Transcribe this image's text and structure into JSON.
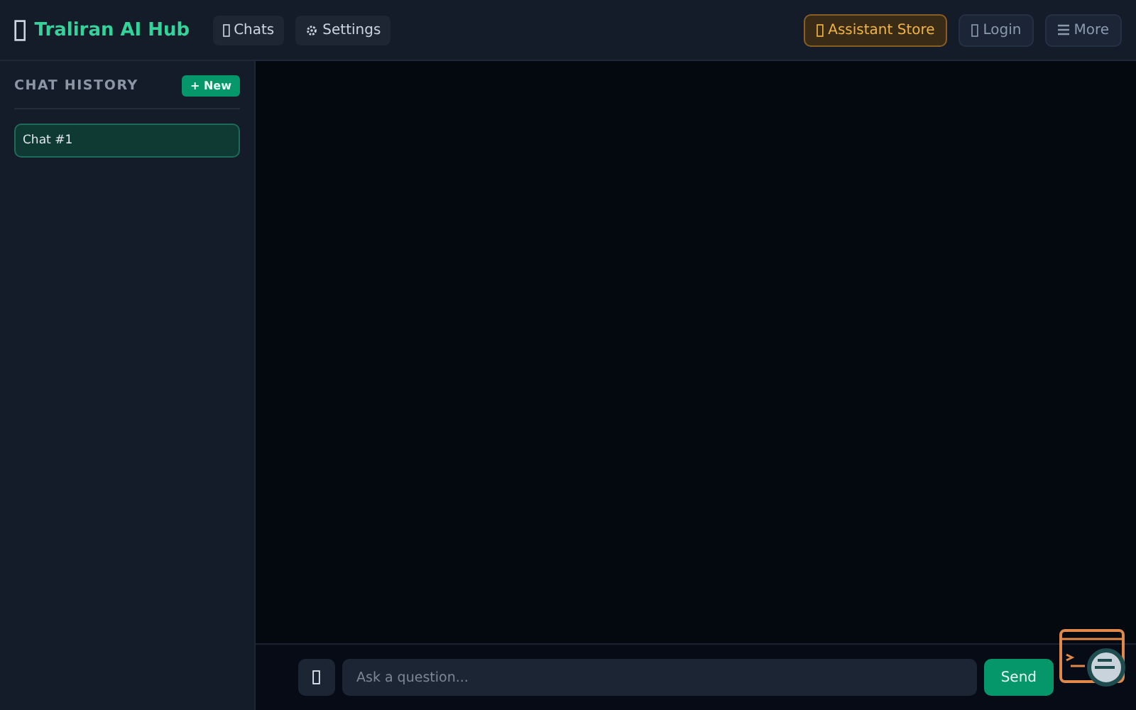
{
  "header": {
    "title": "Traliran AI Hub",
    "nav": [
      {
        "label": "Chats",
        "kind": "box"
      },
      {
        "label": "Settings",
        "kind": "gear"
      }
    ],
    "actions": [
      {
        "label": "Assistant Store",
        "kind": "store"
      },
      {
        "label": "Login",
        "kind": "plain"
      },
      {
        "label": "More",
        "kind": "menu"
      }
    ]
  },
  "sidebar": {
    "heading": "CHAT HISTORY",
    "new_button": "+ New",
    "items": [
      {
        "label": "Chat #1",
        "selected": true
      }
    ]
  },
  "composer": {
    "placeholder": "Ask a question...",
    "send": "Send"
  }
}
